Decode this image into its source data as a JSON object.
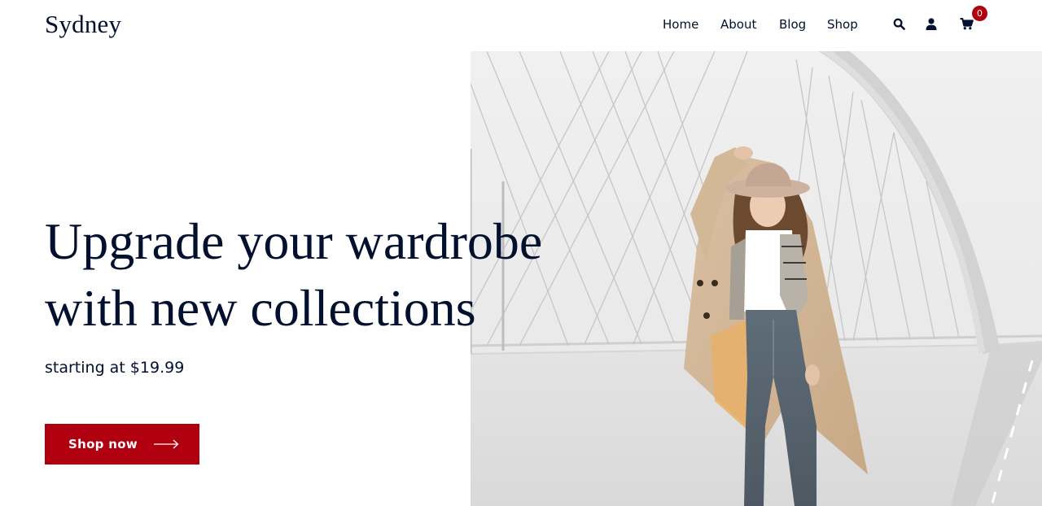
{
  "header": {
    "logo": "Sydney",
    "nav": [
      {
        "label": "Home"
      },
      {
        "label": "About"
      },
      {
        "label": "Blog"
      },
      {
        "label": "Shop"
      }
    ],
    "cart_count": "0",
    "icons": [
      "search-icon",
      "user-icon",
      "cart-icon"
    ]
  },
  "hero": {
    "heading_line1": "Upgrade your wardrobe",
    "heading_line2": "with new collections",
    "subtitle": "starting at $19.99",
    "button_label": "Shop now",
    "image": "woman-in-trench-coat-on-bridge"
  },
  "colors": {
    "brand_text": "#00102e",
    "accent": "#b0000f",
    "background": "#ffffff"
  }
}
